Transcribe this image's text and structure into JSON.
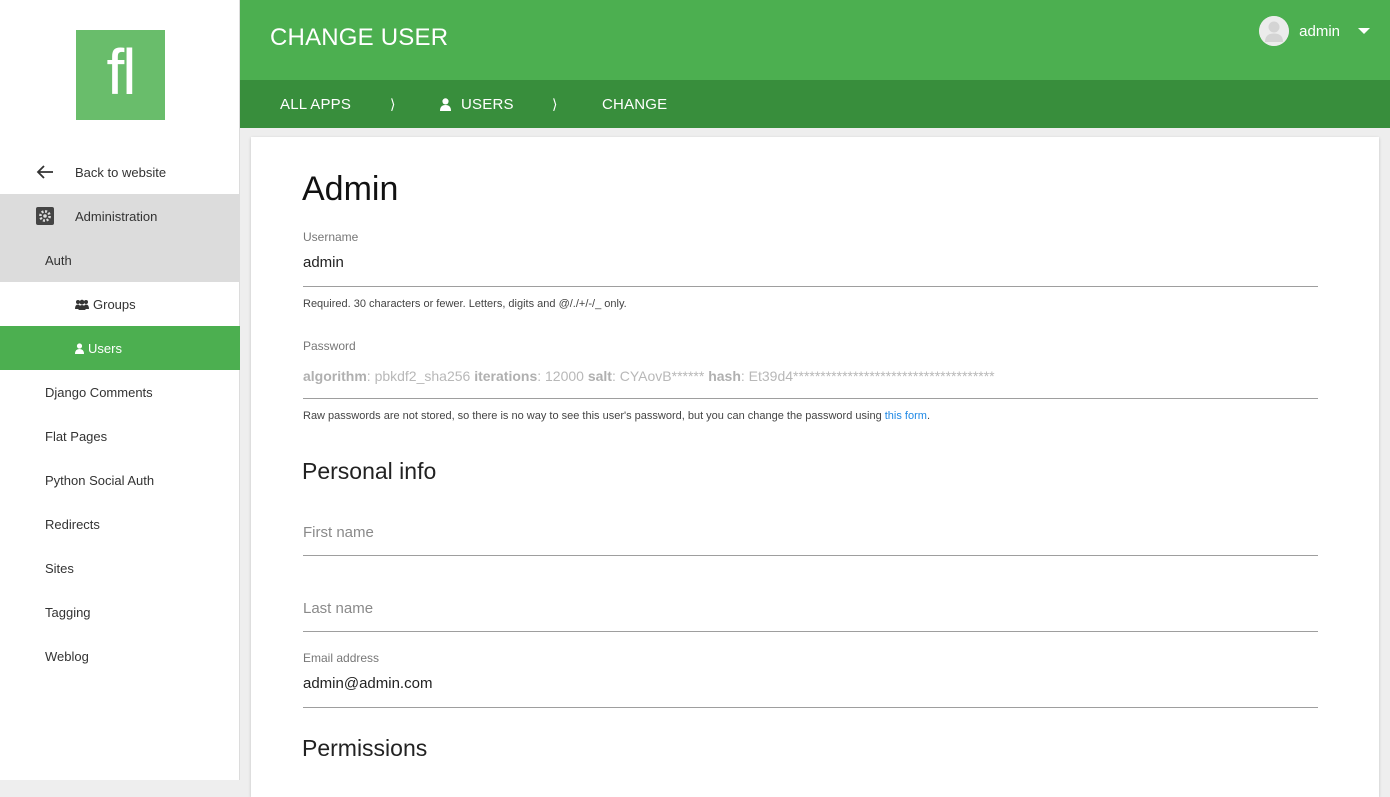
{
  "sidebar": {
    "logo": "fl",
    "back": "Back to website",
    "administration": "Administration",
    "auth": "Auth",
    "groups": "Groups",
    "users": "Users",
    "apps": [
      "Django Comments",
      "Flat Pages",
      "Python Social Auth",
      "Redirects",
      "Sites",
      "Tagging",
      "Weblog"
    ]
  },
  "header": {
    "title": "CHANGE USER",
    "user": "admin"
  },
  "breadcrumb": {
    "all_apps": "ALL APPS",
    "sep": "⟩",
    "users": "USERS",
    "change": "CHANGE"
  },
  "form": {
    "object_title": "Admin",
    "username": {
      "label": "Username",
      "value": "admin",
      "help": "Required. 30 characters or fewer. Letters, digits and @/./+/-/_ only."
    },
    "password": {
      "label": "Password",
      "algorithm_label": "algorithm",
      "algorithm": "pbkdf2_sha256",
      "iterations_label": "iterations",
      "iterations": "12000",
      "salt_label": "salt",
      "salt": "CYAovB******",
      "hash_label": "hash",
      "hash": "Et39d4*************************************",
      "help_prefix": "Raw passwords are not stored, so there is no way to see this user's password, but you can change the password using ",
      "help_link": "this form",
      "help_suffix": "."
    },
    "personal_info": {
      "title": "Personal info",
      "first_name_placeholder": "First name",
      "last_name_placeholder": "Last name",
      "email_label": "Email address",
      "email_value": "admin@admin.com"
    },
    "permissions_title": "Permissions"
  },
  "colors": {
    "primary": "#4caf50",
    "primary_dark": "#388e3c",
    "logo": "#69bd6b",
    "link": "#1e88e5"
  }
}
